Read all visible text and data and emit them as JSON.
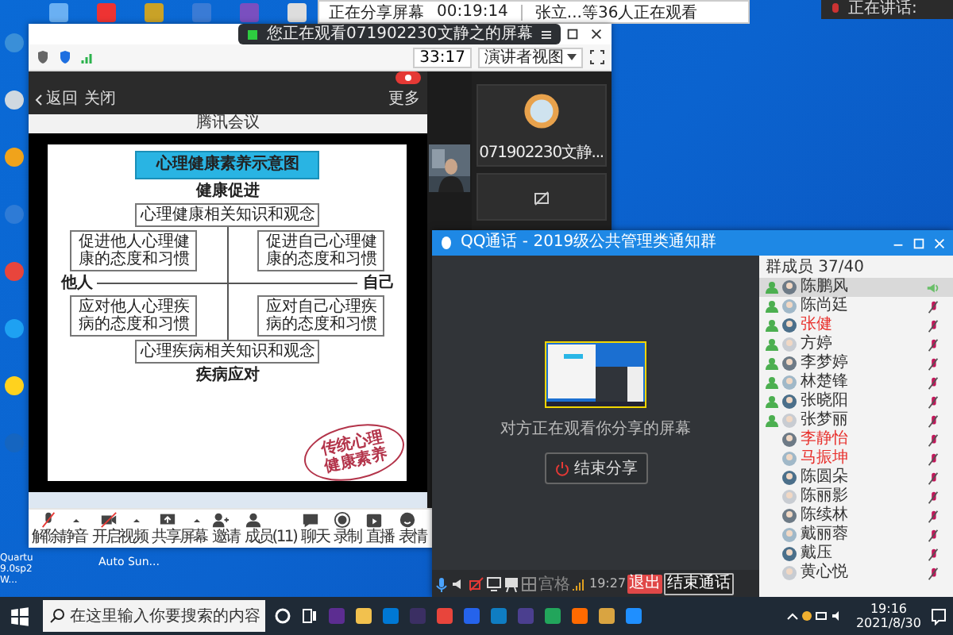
{
  "sharing_banner": {
    "status": "正在分享屏幕",
    "timer": "00:19:14",
    "viewers": "张立...等36人正在观看"
  },
  "speaking_bar": {
    "label": "正在讲话:"
  },
  "desktop": {
    "labels": [
      "Quartu 9.0sp2 W...",
      "Auto Sun..."
    ]
  },
  "meeting": {
    "notice": "您正在观看071902230文静之的屏幕",
    "duration": "33:17",
    "view_button": "演讲者视图",
    "shared_screen": {
      "nav": [
        "返回",
        "关闭"
      ],
      "more": "更多",
      "stage_label": "腾讯会议",
      "slide": {
        "title": "心理健康素养示意图",
        "top_label": "健康促进",
        "top_box": "心理健康相关知识和观念",
        "quadrants": [
          "促进他人心理健康的态度和习惯",
          "促进自己心理健康的态度和习惯",
          "应对他人心理疾病的态度和习惯",
          "应对自己心理疾病的态度和习惯"
        ],
        "left_label": "他人",
        "right_label": "自己",
        "bottom_box": "心理疾病相关知识和观念",
        "bottom_label": "疾病应对",
        "stamp": "传统心理健康素养"
      }
    },
    "participant": {
      "name": "071902230文静..."
    },
    "toolbar": [
      {
        "kind": "mic-off",
        "label": "解除静音",
        "caret": true
      },
      {
        "kind": "video-off",
        "label": "开启视频",
        "caret": true
      },
      {
        "kind": "share",
        "label": "共享屏幕",
        "caret": true
      },
      {
        "kind": "invite",
        "label": "邀请",
        "caret": false
      },
      {
        "kind": "members",
        "label": "成员(11)",
        "caret": false
      },
      {
        "kind": "chat",
        "label": "聊天",
        "caret": false
      },
      {
        "kind": "record",
        "label": "录制",
        "caret": false
      },
      {
        "kind": "live",
        "label": "直播",
        "caret": false
      },
      {
        "kind": "emoji",
        "label": "表情",
        "caret": false
      }
    ]
  },
  "call": {
    "title": "QQ通话 - 2019级公共管理类通知群",
    "status": "对方正在观看你分享的屏幕",
    "end_share": "结束分享",
    "grid": "宫格",
    "time": "19:27",
    "buttons": [
      {
        "label": "退出",
        "kind": "danger"
      },
      {
        "label": "结束通话",
        "kind": "outline"
      }
    ],
    "members_header": "群成员 37/40",
    "members": [
      {
        "name": "陈鹏风",
        "admin": true,
        "selected": true,
        "muted": false,
        "color": "#333333"
      },
      {
        "name": "陈尚廷",
        "admin": true,
        "selected": false,
        "muted": true,
        "color": "#333333"
      },
      {
        "name": "张健",
        "admin": true,
        "selected": false,
        "muted": true,
        "color": "#e8302c"
      },
      {
        "name": "方婷",
        "admin": true,
        "selected": false,
        "muted": true,
        "color": "#333333"
      },
      {
        "name": "李梦婷",
        "admin": true,
        "selected": false,
        "muted": true,
        "color": "#333333"
      },
      {
        "name": "林楚锋",
        "admin": true,
        "selected": false,
        "muted": true,
        "color": "#333333"
      },
      {
        "name": "张晓阳",
        "admin": true,
        "selected": false,
        "muted": true,
        "color": "#333333"
      },
      {
        "name": "张梦丽",
        "admin": true,
        "selected": false,
        "muted": true,
        "color": "#333333"
      },
      {
        "name": "李静怡",
        "admin": false,
        "selected": false,
        "muted": true,
        "color": "#e8302c"
      },
      {
        "name": "马振坤",
        "admin": false,
        "selected": false,
        "muted": true,
        "color": "#e8302c"
      },
      {
        "name": "陈圆朵",
        "admin": false,
        "selected": false,
        "muted": true,
        "color": "#333333"
      },
      {
        "name": "陈丽影",
        "admin": false,
        "selected": false,
        "muted": true,
        "color": "#333333"
      },
      {
        "name": "陈续林",
        "admin": false,
        "selected": false,
        "muted": true,
        "color": "#333333"
      },
      {
        "name": "戴丽蓉",
        "admin": false,
        "selected": false,
        "muted": true,
        "color": "#333333"
      },
      {
        "name": "戴压",
        "admin": false,
        "selected": false,
        "muted": true,
        "color": "#333333"
      },
      {
        "name": "黄心悦",
        "admin": false,
        "selected": false,
        "muted": true,
        "color": "#333333"
      }
    ]
  },
  "taskbar": {
    "search_placeholder": "在这里输入你要搜索的内容",
    "time": "19:16",
    "date": "2021/8/30"
  }
}
